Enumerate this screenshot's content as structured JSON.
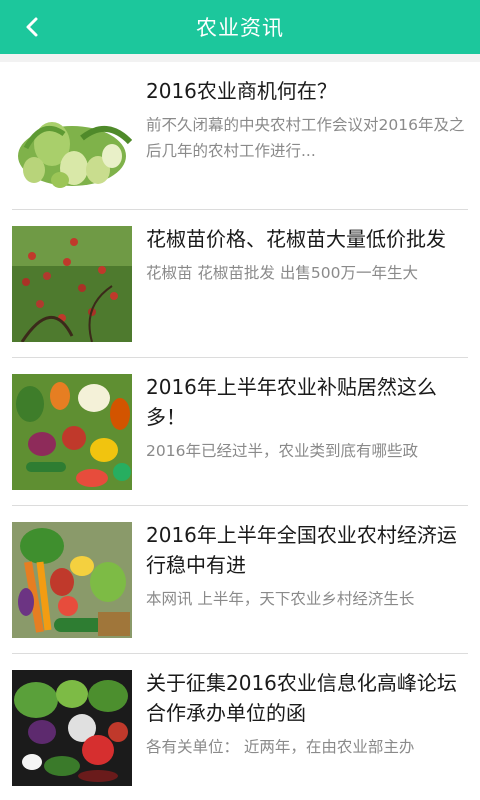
{
  "header": {
    "title": "农业资讯"
  },
  "icons": {
    "back": "back-arrow-icon"
  },
  "colors": {
    "header_bg": "#1cc79c",
    "headline": "#1a1a1a",
    "summary": "#8a8a8a"
  },
  "articles": [
    {
      "headline": "2016农业商机何在？",
      "summary": "前不久闭幕的中央农村工作会议对2016年及之后几年的农村工作进行..."
    },
    {
      "headline": "花椒苗价格、花椒苗大量低价批发",
      "summary": "花椒苗 花椒苗批发 出售500万一年生大"
    },
    {
      "headline": "2016年上半年农业补贴居然这么多！",
      "summary": "2016年已经过半，农业类到底有哪些政"
    },
    {
      "headline": "2016年上半年全国农业农村经济运行稳中有进",
      "summary": "本网讯 上半年，天下农业乡村经济生长"
    },
    {
      "headline": "关于征集2016农业信息化高峰论坛合作承办单位的函",
      "summary": "各有关单位：  近两年，在由农业部主办"
    }
  ]
}
